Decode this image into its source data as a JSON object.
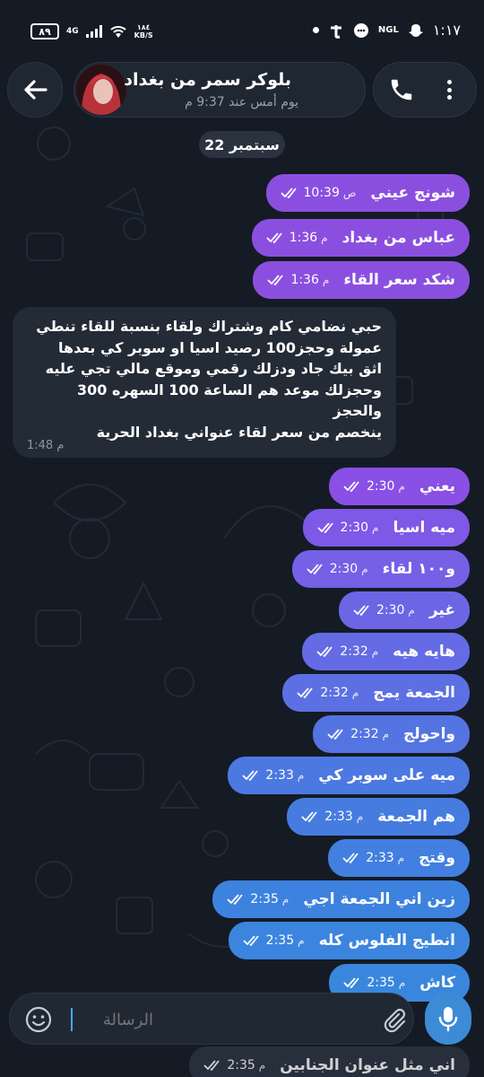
{
  "status_bar": {
    "battery": "٨٩",
    "network": "4G",
    "speed_value": "١٨٤",
    "speed_unit": "KB/S",
    "time": "١:١٧",
    "ngl": "NGL"
  },
  "header": {
    "title": "بلوكر سمر من بغداد",
    "subtitle": "يوم أمس عند 9:37 م"
  },
  "date_chip": "22 سبتمبر",
  "messages": [
    {
      "text": "شونج عيني",
      "time": "10:39",
      "ampm": "ص"
    },
    {
      "text": "عباس من بغداد",
      "time": "1:36",
      "ampm": "م"
    },
    {
      "text": "شكد سعر القاء",
      "time": "1:36",
      "ampm": "م"
    },
    {
      "text": "يعني",
      "time": "2:30",
      "ampm": "م"
    },
    {
      "text": "ميه اسيا",
      "time": "2:30",
      "ampm": "م"
    },
    {
      "text": "و١٠٠ لقاء",
      "time": "2:30",
      "ampm": "م"
    },
    {
      "text": "غير",
      "time": "2:30",
      "ampm": "م"
    },
    {
      "text": "هايه هيه",
      "time": "2:32",
      "ampm": "م"
    },
    {
      "text": "الجمعة يمج",
      "time": "2:32",
      "ampm": "م"
    },
    {
      "text": "واحولج",
      "time": "2:32",
      "ampm": "م"
    },
    {
      "text": "ميه على سوبر كي",
      "time": "2:33",
      "ampm": "م"
    },
    {
      "text": "هم الجمعة",
      "time": "2:33",
      "ampm": "م"
    },
    {
      "text": "وقتج",
      "time": "2:33",
      "ampm": "م"
    },
    {
      "text": "زين اني الجمعة اجي",
      "time": "2:35",
      "ampm": "م"
    },
    {
      "text": "انطيج الفلوس كله",
      "time": "2:35",
      "ampm": "م"
    },
    {
      "text": "كاش",
      "time": "2:35",
      "ampm": "م"
    },
    {
      "text": "اني مثل عنوان الجنابين",
      "time": "2:35",
      "ampm": "م"
    }
  ],
  "incoming": {
    "lines": [
      "حبي نضامي كام وشتراك ولقاء بنسبة للقاء تنطي",
      "عمولة وحجز100  رصيد اسيا او سوبر كي بعدها",
      "اثق بيك جاد ودزلك رقمي وموقع مالي تجي عليه",
      "وحجزلك موعد هم الساعة 100 السهره 300 والحجز",
      "ينخصم من سعر لقاء عنواني بغداد الحرية"
    ],
    "time": "1:48",
    "ampm": "م"
  },
  "input": {
    "placeholder": "الرسالة"
  },
  "colors": {
    "background": "#141b24",
    "purple_bubble": "#8b4fe0",
    "blue_bubble": "#3d7fe0",
    "incoming_bubble": "#232b36",
    "mic_button": "#3d8bd6"
  }
}
